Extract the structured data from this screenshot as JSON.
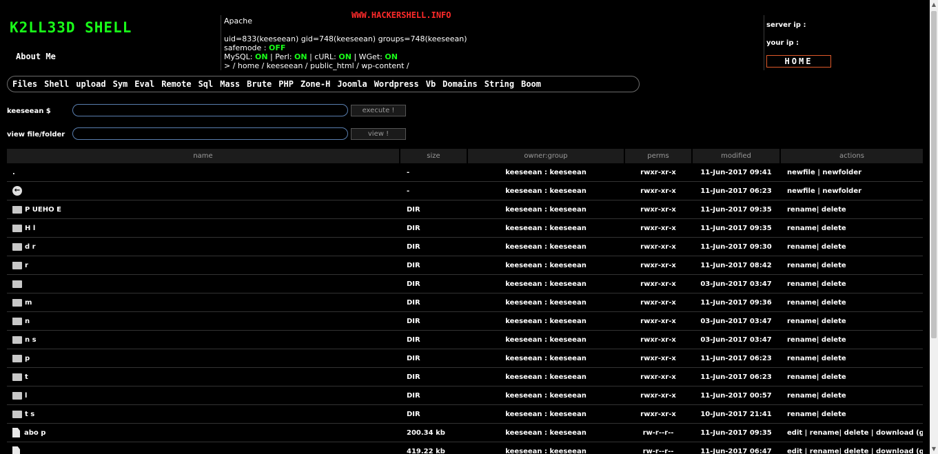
{
  "header": {
    "logo": "K2LL33D SHELL",
    "about": "About Me",
    "site_banner": "WWW.HACKERSHELL.INFO",
    "server_software": "Apache",
    "uid_line": "uid=833(keeseean) gid=748(keeseean) groups=748(keeseean)",
    "safemode_label": "safemode : ",
    "safemode_value": "OFF",
    "mysql_label": "MySQL: ",
    "mysql_value": "ON",
    "perl_label": " | Perl: ",
    "perl_value": "ON",
    "curl_label": " | cURL: ",
    "curl_value": "ON",
    "wget_label": " | WGet: ",
    "wget_value": "ON",
    "path": " >  / home / keeseean / public_html / wp-content /",
    "server_ip_label": "server ip :",
    "your_ip_label": "your ip :",
    "home_button": "HOME",
    "status_on_color": "#19ff19",
    "logo_color": "#19ff19",
    "banner_color": "#ff2a2a"
  },
  "menu": [
    "Files",
    "Shell",
    "upload",
    "Sym",
    "Eval",
    "Remote",
    "Sql",
    "Mass",
    "Brute",
    "PHP",
    "Zone-H",
    "Joomla",
    "Wordpress",
    "Vb",
    "Domains",
    "String",
    "Boom"
  ],
  "command_form": {
    "label": "keeseean $",
    "value": "",
    "button": "execute !"
  },
  "view_form": {
    "label": "view file/folder",
    "value": "",
    "button": "view !"
  },
  "table": {
    "headers": {
      "name": "name",
      "size": "size",
      "owner": "owner:group",
      "perms": "perms",
      "modified": "modified",
      "actions": "actions"
    },
    "rows": [
      {
        "type": "dot",
        "name": ".",
        "size": "-",
        "owner": "keeseean : keeseean",
        "perms": "rwxr-xr-x",
        "modified": "11-Jun-2017 09:41",
        "actions": "newfile | newfolder"
      },
      {
        "type": "back",
        "name": "",
        "size": "-",
        "owner": "keeseean : keeseean",
        "perms": "rwxr-xr-x",
        "modified": "11-Jun-2017 06:23",
        "actions": "newfile | newfolder"
      },
      {
        "type": "dir",
        "name": "P  UEHO  E",
        "size": "DIR",
        "owner": "keeseean : keeseean",
        "perms": "rwxr-xr-x",
        "modified": "11-Jun-2017 09:35",
        "actions": "rename| delete"
      },
      {
        "type": "dir",
        "name": "H     l",
        "size": "DIR",
        "owner": "keeseean : keeseean",
        "perms": "rwxr-xr-x",
        "modified": "11-Jun-2017 09:35",
        "actions": "rename| delete"
      },
      {
        "type": "dir",
        "name": "d    r",
        "size": "DIR",
        "owner": "keeseean : keeseean",
        "perms": "rwxr-xr-x",
        "modified": "11-Jun-2017 09:30",
        "actions": "rename| delete"
      },
      {
        "type": "dir",
        "name": "   r",
        "size": "DIR",
        "owner": "keeseean : keeseean",
        "perms": "rwxr-xr-x",
        "modified": "11-Jun-2017 08:42",
        "actions": "rename| delete"
      },
      {
        "type": "dir",
        "name": "",
        "size": "DIR",
        "owner": "keeseean : keeseean",
        "perms": "rwxr-xr-x",
        "modified": "03-Jun-2017 03:47",
        "actions": "rename| delete"
      },
      {
        "type": "dir",
        "name": "m",
        "size": "DIR",
        "owner": "keeseean : keeseean",
        "perms": "rwxr-xr-x",
        "modified": "11-Jun-2017 09:36",
        "actions": "rename| delete"
      },
      {
        "type": "dir",
        "name": "n",
        "size": "DIR",
        "owner": "keeseean : keeseean",
        "perms": "rwxr-xr-x",
        "modified": "03-Jun-2017 03:47",
        "actions": "rename| delete"
      },
      {
        "type": "dir",
        "name": "n      s",
        "size": "DIR",
        "owner": "keeseean : keeseean",
        "perms": "rwxr-xr-x",
        "modified": "03-Jun-2017 03:47",
        "actions": "rename| delete"
      },
      {
        "type": "dir",
        "name": "p",
        "size": "DIR",
        "owner": "keeseean : keeseean",
        "perms": "rwxr-xr-x",
        "modified": "11-Jun-2017 06:23",
        "actions": "rename| delete"
      },
      {
        "type": "dir",
        "name": "t",
        "size": "DIR",
        "owner": "keeseean : keeseean",
        "perms": "rwxr-xr-x",
        "modified": "11-Jun-2017 06:23",
        "actions": "rename| delete"
      },
      {
        "type": "dir",
        "name": "   l",
        "size": "DIR",
        "owner": "keeseean : keeseean",
        "perms": "rwxr-xr-x",
        "modified": "11-Jun-2017 00:57",
        "actions": "rename| delete"
      },
      {
        "type": "dir",
        "name": "t    s",
        "size": "DIR",
        "owner": "keeseean : keeseean",
        "perms": "rwxr-xr-x",
        "modified": "10-Jun-2017 21:41",
        "actions": "rename| delete"
      },
      {
        "type": "file",
        "name": "  abo  p",
        "size": "200.34 kb",
        "owner": "keeseean : keeseean",
        "perms": "rw-r--r--",
        "modified": "11-Jun-2017 09:35",
        "actions": "edit | rename| delete | download (gz)"
      },
      {
        "type": "file",
        "name": "",
        "size": "419.22 kb",
        "owner": "keeseean : keeseean",
        "perms": "rw-r--r--",
        "modified": "11-Jun-2017 06:47",
        "actions": "edit | rename| delete | download (gz)"
      }
    ]
  }
}
